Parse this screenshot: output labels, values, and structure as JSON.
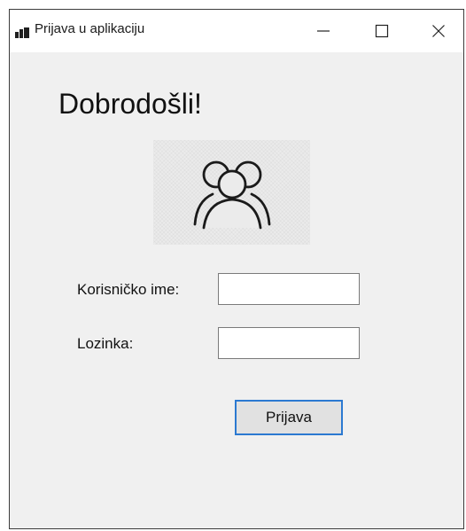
{
  "window": {
    "title": "Prijava u aplikaciju",
    "minimize_icon": "minimize-icon",
    "maximize_icon": "maximize-icon",
    "close_icon": "close-icon"
  },
  "form": {
    "heading": "Dobrodošli!",
    "picture_icon": "users-group-icon",
    "username_label": "Korisničko ime:",
    "username_value": "",
    "password_label": "Lozinka:",
    "password_value": "",
    "submit_label": "Prijava"
  },
  "colors": {
    "window_bg": "#f0f0f0",
    "titlebar_bg": "#ffffff",
    "button_focus_border": "#2b79d1",
    "button_bg": "#e1e1e1"
  }
}
